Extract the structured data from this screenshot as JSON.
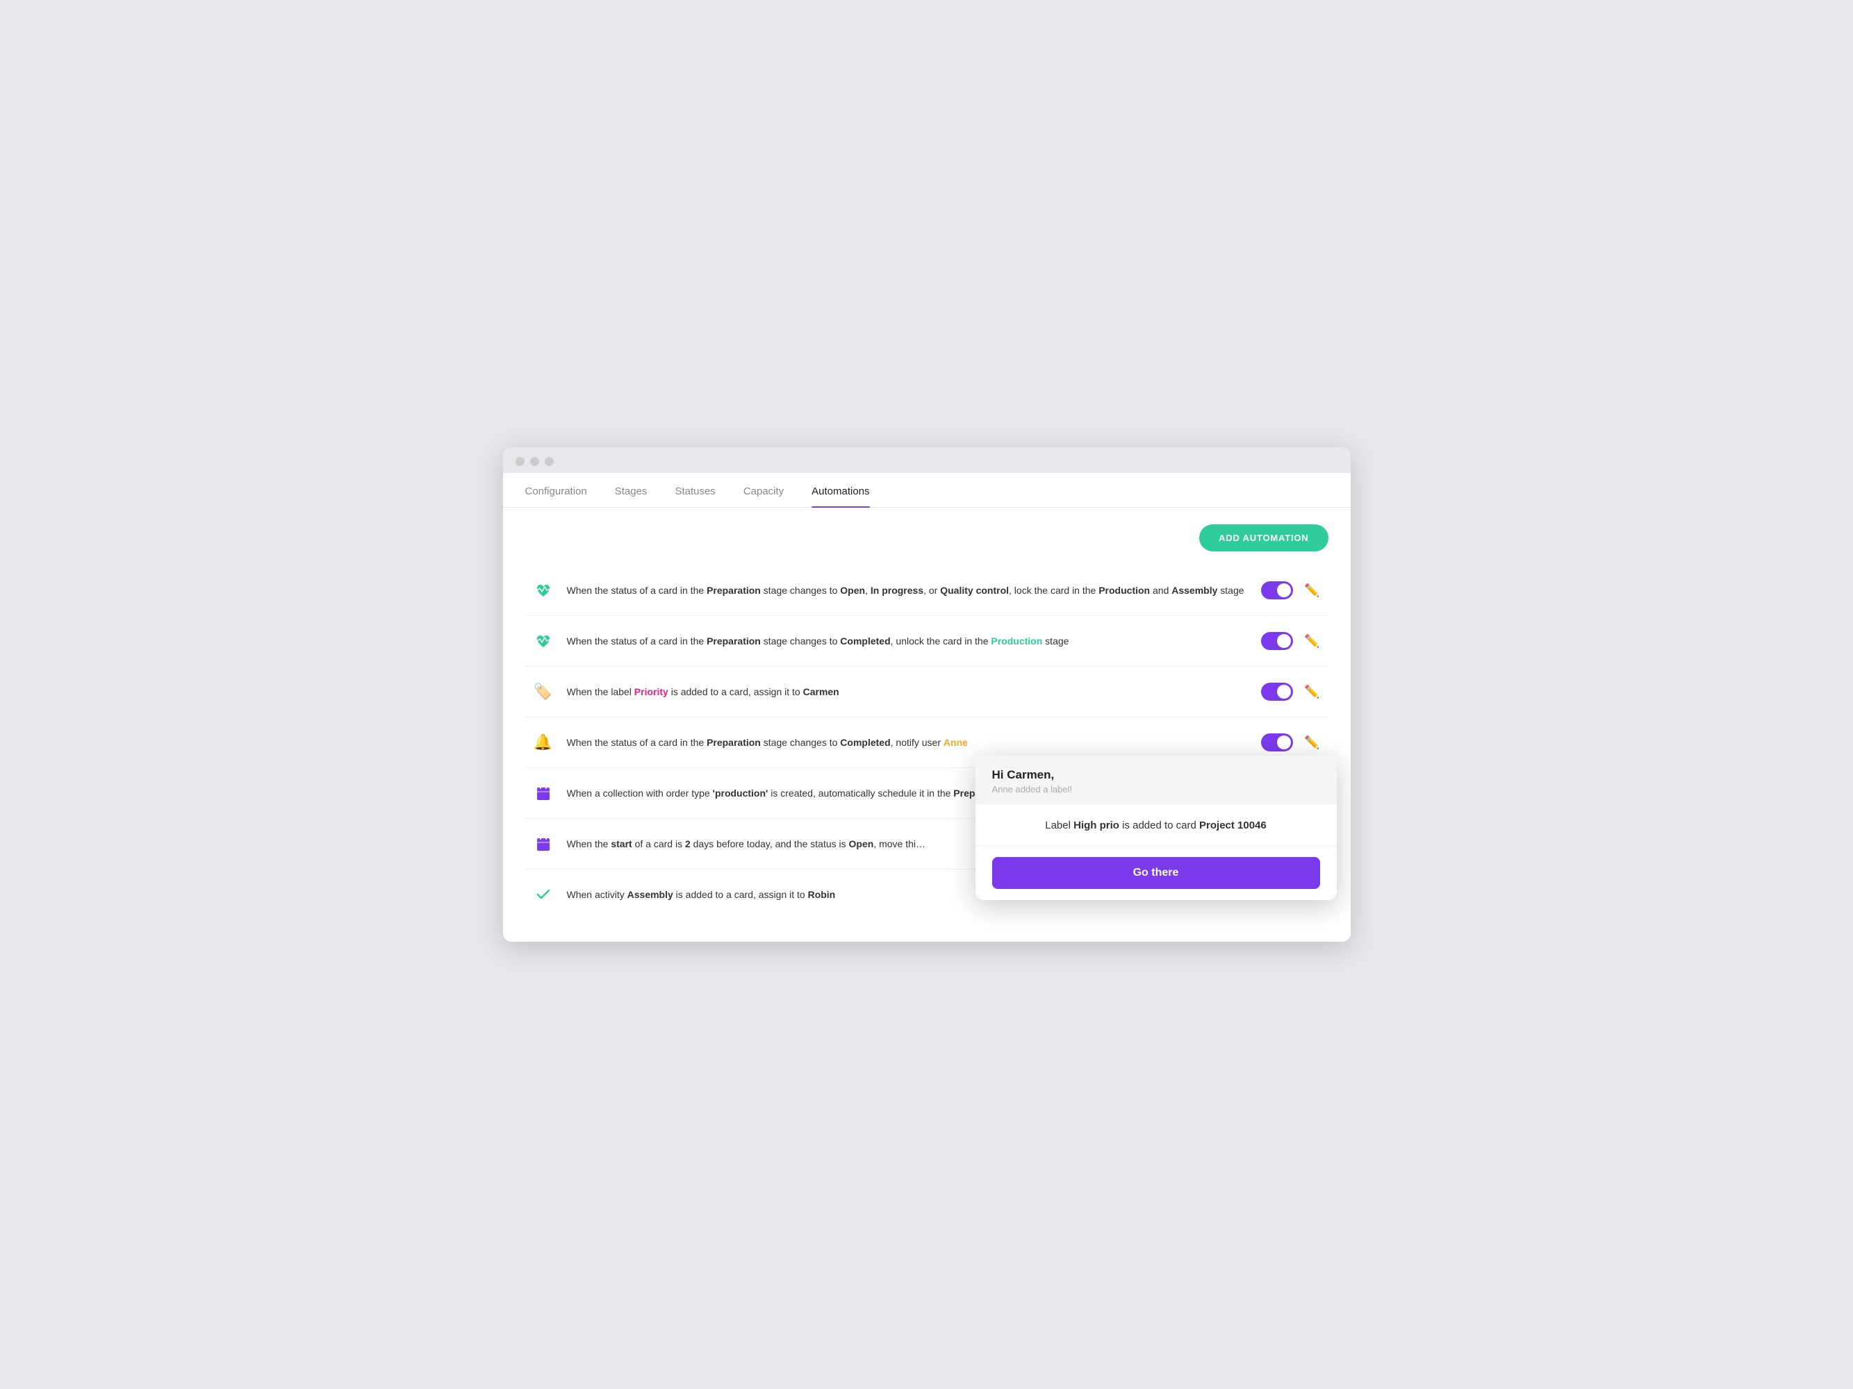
{
  "window": {
    "titlebar": {
      "dots": [
        "dot1",
        "dot2",
        "dot3"
      ]
    }
  },
  "tabs": [
    {
      "label": "Configuration",
      "active": false
    },
    {
      "label": "Stages",
      "active": false
    },
    {
      "label": "Statuses",
      "active": false
    },
    {
      "label": "Capacity",
      "active": false
    },
    {
      "label": "Automations",
      "active": true
    }
  ],
  "toolbar": {
    "add_button_label": "ADD AUTOMATION"
  },
  "automations": [
    {
      "id": 1,
      "icon": "❤️",
      "icon_color": "#2ecc9a",
      "text_html": "When the status of a card in the <b>Preparation</b> stage changes to <b>Open</b>, <b>In progress</b>, or <b>Quality control</b>, lock the card in the <b>Production</b> and <b>Assembly</b> stage",
      "enabled": true
    },
    {
      "id": 2,
      "icon": "❤️",
      "icon_color": "#2ecc9a",
      "text_html": "When the status of a card in the <b>Preparation</b> stage changes to <b>Completed</b>, unlock the card in the <span class='green'>Production</span> stage",
      "enabled": true
    },
    {
      "id": 3,
      "icon": "🏷️",
      "icon_color": "#c87941",
      "text_html": "When the label <span class='pink'>Priority</span> is added to a card, assign it to <b>Carmen</b>",
      "enabled": true
    },
    {
      "id": 4,
      "icon": "🔔",
      "icon_color": "#f5c542",
      "text_html": "When the status of a card in the <b>Preparation</b> stage changes to <b>Completed</b>, notify user <span class='orange'>Anne</span>",
      "enabled": true
    },
    {
      "id": 5,
      "icon": "📅",
      "icon_color": "#7c3aed",
      "text_html": "When a collection with order type <b>'production'</b> is created, automatically schedule it in the <b>Preparation</b> stage for a <b>due date minus 5 business days</b>",
      "enabled": true
    },
    {
      "id": 6,
      "icon": "📅",
      "icon_color": "#7c3aed",
      "text_html": "When the <b>start</b> of a card is <b>2</b> days before today, and the status is <b>Open</b>, move thi...",
      "enabled": false,
      "no_toggle": true
    },
    {
      "id": 7,
      "icon": "✔️",
      "icon_color": "#2ecc9a",
      "text_html": "When activity <b>Assembly</b> is added to a card, assign it to <b>Robin</b>",
      "enabled": false,
      "no_toggle": true
    }
  ],
  "notification": {
    "greeting": "Hi Carmen,",
    "subtitle": "Anne added a label!",
    "body": "Label <b>High prio</b> is added to card <b>Project 10046</b>",
    "go_there_label": "Go there"
  }
}
